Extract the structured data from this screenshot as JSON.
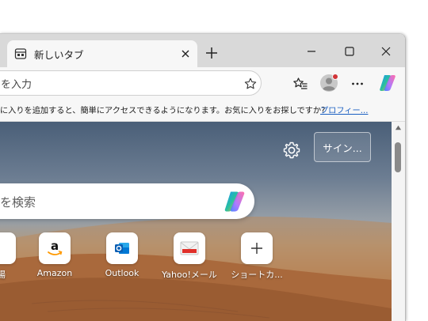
{
  "tab": {
    "title": "新しいタブ"
  },
  "address": {
    "text": "を入力"
  },
  "favbar": {
    "message": "に入りを追加すると、簡単にアクセスできるようになります。お気に入りをお探しですか?",
    "link": "プロフィー..."
  },
  "page": {
    "signin_label": "サイン...",
    "search_placeholder": "を検索",
    "tiles": [
      {
        "label": "場",
        "icon": "partial-icon"
      },
      {
        "label": "Amazon",
        "icon": "amazon-icon"
      },
      {
        "label": "Outlook",
        "icon": "outlook-icon"
      },
      {
        "label": "Yahoo!メール",
        "icon": "yahoo-mail-icon"
      },
      {
        "label": "ショートカ...",
        "icon": "plus-icon"
      }
    ]
  },
  "colors": {
    "tabstrip": "#d9d9d9",
    "toolbar": "#f7f7f7",
    "link": "#1a5fc2",
    "notification_dot": "#d13438"
  }
}
